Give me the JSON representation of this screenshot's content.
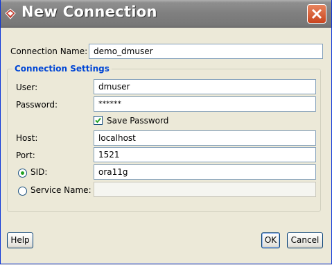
{
  "window": {
    "title": "New Connection"
  },
  "connection_name": {
    "label": "Connection Name:",
    "value": "demo_dmuser"
  },
  "settings": {
    "title": "Connection Settings",
    "user": {
      "label": "User:",
      "value": "dmuser"
    },
    "password": {
      "label": "Password:",
      "value": "******"
    },
    "save_password": {
      "label": "Save Password",
      "checked": true
    },
    "host": {
      "label": "Host:",
      "value": "localhost"
    },
    "port": {
      "label": "Port:",
      "value": "1521"
    },
    "sid": {
      "label": "SID:",
      "value": "ora11g",
      "selected": true
    },
    "service_name": {
      "label": "Service Name:",
      "value": "",
      "selected": false
    }
  },
  "buttons": {
    "help": "Help",
    "ok": "OK",
    "cancel": "Cancel"
  },
  "icons": {
    "app": "oracle-diamond-icon",
    "close": "close-icon",
    "check": "checkmark-icon"
  },
  "colors": {
    "accent": "#0046d5",
    "close": "#c9451f",
    "radio_dot": "#21a121"
  }
}
